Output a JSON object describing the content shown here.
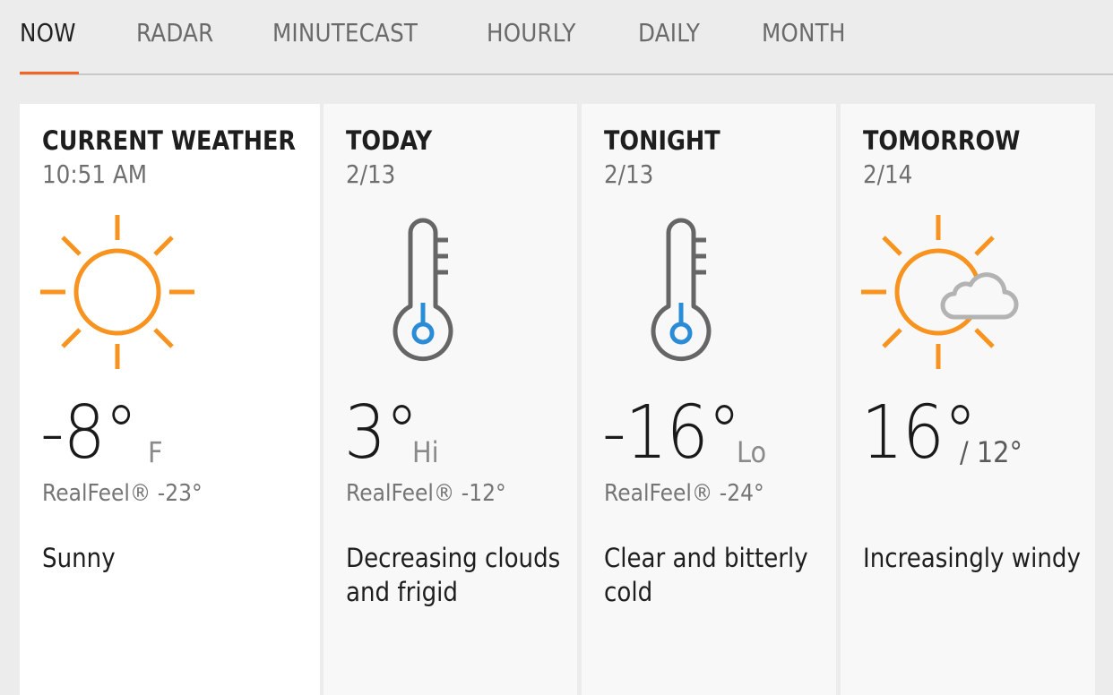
{
  "tabs": [
    {
      "label": "NOW",
      "active": true
    },
    {
      "label": "RADAR"
    },
    {
      "label": "MINUTECAST"
    },
    {
      "label": "HOURLY"
    },
    {
      "label": "DAILY"
    },
    {
      "label": "MONTH"
    }
  ],
  "colors": {
    "accent": "#f26522",
    "sun": "#f7931e",
    "thermo_blue": "#2a8bd7",
    "thermo_gray": "#666666",
    "cloud": "#b3b3b3"
  },
  "cards": [
    {
      "title": "CURRENT WEATHER",
      "subtitle": "10:51 AM",
      "icon": "sun-icon",
      "temp": "-8°",
      "suffix": "F",
      "realfeel": "RealFeel® -23°",
      "phrase": "Sunny"
    },
    {
      "title": "TODAY",
      "subtitle": "2/13",
      "icon": "thermometer-cold-icon",
      "temp": "3°",
      "suffix": "Hi",
      "realfeel": "RealFeel® -12°",
      "phrase": "Decreasing clouds and frigid"
    },
    {
      "title": "TONIGHT",
      "subtitle": "2/13",
      "icon": "thermometer-cold-icon",
      "temp": "-16°",
      "suffix": "Lo",
      "realfeel": "RealFeel® -24°",
      "phrase": "Clear and bitterly cold"
    },
    {
      "title": "TOMORROW",
      "subtitle": "2/14",
      "icon": "sun-cloud-icon",
      "temp": "16°",
      "suffix": "/ 12°",
      "realfeel": "",
      "phrase": "Increasingly windy"
    }
  ]
}
